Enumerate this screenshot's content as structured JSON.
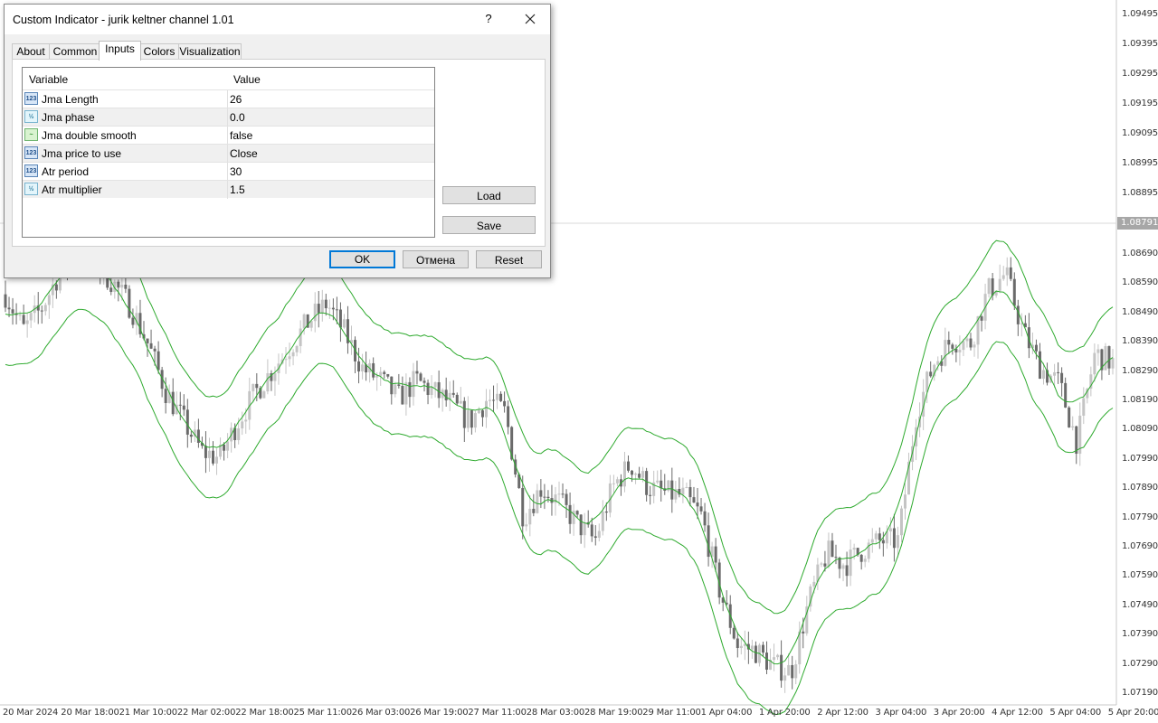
{
  "dialog": {
    "title": "Custom Indicator - jurik keltner channel 1.01",
    "help_label": "?",
    "tabs": [
      {
        "label": "About"
      },
      {
        "label": "Common"
      },
      {
        "label": "Inputs"
      },
      {
        "label": "Colors"
      },
      {
        "label": "Visualization"
      }
    ],
    "active_tab": "Inputs",
    "grid": {
      "col_variable": "Variable",
      "col_value": "Value",
      "rows": [
        {
          "variable": "Jma Length",
          "value": "26",
          "icon": "integer-icon",
          "icon_text": "123"
        },
        {
          "variable": "Jma phase",
          "value": "0.0",
          "icon": "double-icon",
          "icon_text": "½"
        },
        {
          "variable": "Jma double smooth",
          "value": "false",
          "icon": "boolean-icon",
          "icon_text": "~"
        },
        {
          "variable": "Jma price to use",
          "value": "Close",
          "icon": "enum-icon",
          "icon_text": "123"
        },
        {
          "variable": "Atr period",
          "value": "30",
          "icon": "integer-icon",
          "icon_text": "123"
        },
        {
          "variable": "Atr multiplier",
          "value": "1.5",
          "icon": "double-icon",
          "icon_text": "½"
        }
      ]
    },
    "buttons": {
      "load": "Load",
      "save": "Save",
      "ok": "OK",
      "cancel": "Отмена",
      "reset": "Reset"
    }
  },
  "chart": {
    "current_price": "1.08791",
    "price_labels": [
      "1.09495",
      "1.09395",
      "1.09295",
      "1.09195",
      "1.09095",
      "1.08995",
      "1.08895",
      "1.08690",
      "1.08590",
      "1.08490",
      "1.08390",
      "1.08290",
      "1.08190",
      "1.08090",
      "1.07990",
      "1.07890",
      "1.07790",
      "1.07690",
      "1.07590",
      "1.07490",
      "1.07390",
      "1.07290",
      "1.07190"
    ],
    "time_labels": [
      "20 Mar 2024",
      "20 Mar 18:00",
      "21 Mar 10:00",
      "22 Mar 02:00",
      "22 Mar 18:00",
      "25 Mar 11:00",
      "26 Mar 03:00",
      "26 Mar 19:00",
      "27 Mar 11:00",
      "28 Mar 03:00",
      "28 Mar 19:00",
      "29 Mar 11:00",
      "1 Apr 04:00",
      "1 Apr 20:00",
      "2 Apr 12:00",
      "3 Apr 04:00",
      "3 Apr 20:00",
      "4 Apr 12:00",
      "5 Apr 04:00",
      "5 Apr 20:00"
    ],
    "colors": {
      "channel": "#2eaa2e",
      "bull_candle": "#c4c4c4",
      "bear_candle": "#6a6a6a",
      "background": "#ffffff"
    }
  },
  "chart_data": {
    "type": "candlestick",
    "series": [
      {
        "name": "candles",
        "close_path_price": [
          1.0855,
          1.0843,
          1.085,
          1.0862,
          1.087,
          1.0866,
          1.0859,
          1.0851,
          1.0838,
          1.0822,
          1.0812,
          1.0802,
          1.08,
          1.0812,
          1.0822,
          1.083,
          1.0838,
          1.0846,
          1.0852,
          1.0842,
          1.083,
          1.0826,
          1.082,
          1.0826,
          1.0822,
          1.0818,
          1.0812,
          1.082,
          1.0815,
          1.078,
          1.079,
          1.0785,
          1.0778,
          1.0772,
          1.079,
          1.0798,
          1.079,
          1.0788,
          1.0787,
          1.078,
          1.0755,
          1.0737,
          1.0735,
          1.073,
          1.0728,
          1.0752,
          1.0768,
          1.0764,
          1.0769,
          1.0772,
          1.0772,
          1.0815,
          1.0832,
          1.084,
          1.0838,
          1.0856,
          1.0862,
          1.0842,
          1.083,
          1.0825,
          1.0805,
          1.0835,
          1.0832
        ]
      }
    ],
    "ylim": [
      1.0718,
      1.09495
    ]
  }
}
